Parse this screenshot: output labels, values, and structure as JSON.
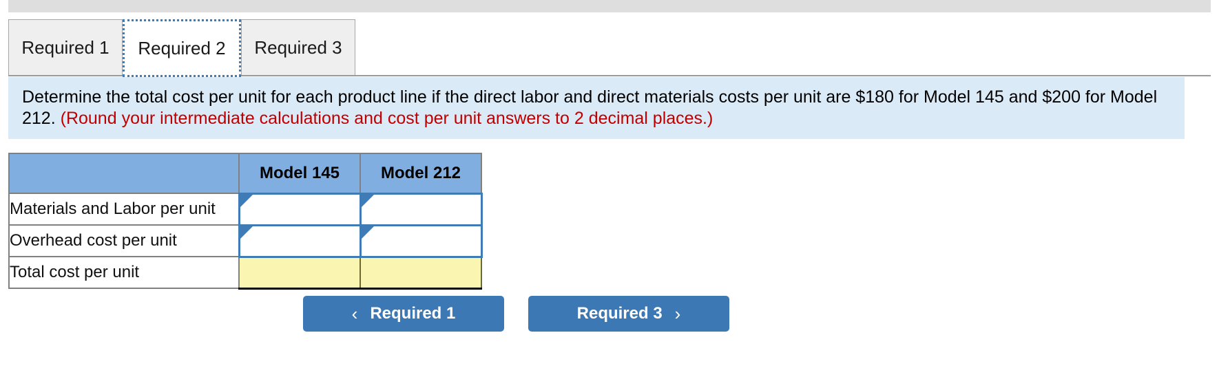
{
  "tabs": [
    {
      "label": "Required 1",
      "active": false
    },
    {
      "label": "Required 2",
      "active": true
    },
    {
      "label": "Required 3",
      "active": false
    }
  ],
  "instruction": {
    "main": "Determine the total cost per unit for each product line if the direct labor and direct materials costs per unit are $180 for Model 145 and $200 for Model 212.",
    "note": "(Round your intermediate calculations and cost per unit answers to 2 decimal places.)"
  },
  "table": {
    "corner_header": "",
    "column_headers": [
      "Model 145",
      "Model 212"
    ],
    "rows": [
      {
        "label": "Materials and Labor per unit",
        "type": "input",
        "values": [
          "",
          ""
        ]
      },
      {
        "label": "Overhead cost per unit",
        "type": "input",
        "values": [
          "",
          ""
        ]
      },
      {
        "label": "Total cost per unit",
        "type": "total",
        "values": [
          "",
          ""
        ]
      }
    ]
  },
  "navigation": {
    "prev": {
      "label": "Required 1",
      "icon": "chevron-left-icon",
      "glyph": "‹"
    },
    "next": {
      "label": "Required 3",
      "icon": "chevron-right-icon",
      "glyph": "›"
    }
  },
  "colors": {
    "header_blue": "#81aee0",
    "panel_blue": "#dbeaf7",
    "note_red": "#c00000",
    "total_yellow": "#faf5b0",
    "button_blue": "#3c78b4",
    "focus_blue": "#3f7cb6",
    "top_band_gray": "#dedede",
    "tab_gray": "#efefef"
  }
}
